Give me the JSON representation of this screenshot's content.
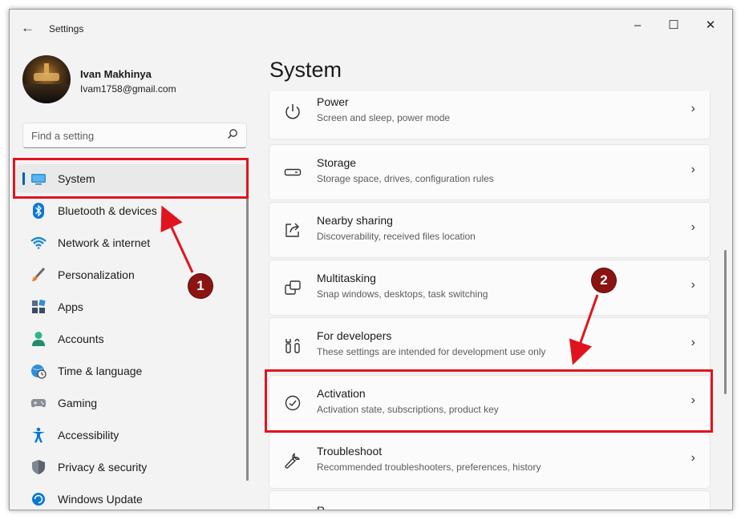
{
  "window": {
    "app_title": "Settings",
    "back_icon": "arrow-left-icon",
    "controls": [
      "minimize-icon",
      "maximize-icon",
      "close-icon"
    ]
  },
  "profile": {
    "name": "Ivan Makhinya",
    "email": "Ivam1758@gmail.com"
  },
  "search": {
    "placeholder": "Find a setting",
    "icon": "search-icon"
  },
  "sidebar": {
    "items": [
      {
        "label": "System",
        "icon": "system-icon",
        "active": true
      },
      {
        "label": "Bluetooth & devices",
        "icon": "bluetooth-icon"
      },
      {
        "label": "Network & internet",
        "icon": "wifi-icon"
      },
      {
        "label": "Personalization",
        "icon": "brush-icon"
      },
      {
        "label": "Apps",
        "icon": "apps-icon"
      },
      {
        "label": "Accounts",
        "icon": "accounts-icon"
      },
      {
        "label": "Time & language",
        "icon": "globe-clock-icon"
      },
      {
        "label": "Gaming",
        "icon": "gamepad-icon"
      },
      {
        "label": "Accessibility",
        "icon": "accessibility-icon"
      },
      {
        "label": "Privacy & security",
        "icon": "shield-icon"
      },
      {
        "label": "Windows Update",
        "icon": "update-icon"
      }
    ]
  },
  "main": {
    "title": "System",
    "cards": [
      {
        "title": "Power",
        "subtitle": "Screen and sleep, power mode",
        "icon": "power-icon"
      },
      {
        "title": "Storage",
        "subtitle": "Storage space, drives, configuration rules",
        "icon": "storage-icon"
      },
      {
        "title": "Nearby sharing",
        "subtitle": "Discoverability, received files location",
        "icon": "share-icon"
      },
      {
        "title": "Multitasking",
        "subtitle": "Snap windows, desktops, task switching",
        "icon": "multitasking-icon"
      },
      {
        "title": "For developers",
        "subtitle": "These settings are intended for development use only",
        "icon": "developer-tools-icon"
      },
      {
        "title": "Activation",
        "subtitle": "Activation state, subscriptions, product key",
        "icon": "checkmark-circle-icon"
      },
      {
        "title": "Troubleshoot",
        "subtitle": "Recommended troubleshooters, preferences, history",
        "icon": "wrench-icon"
      },
      {
        "title": "R",
        "subtitle": "",
        "icon": ""
      }
    ]
  },
  "annotations": {
    "badge_1": "1",
    "badge_2": "2",
    "highlight_color": "#e0141e",
    "badge_color": "#8b1413"
  }
}
